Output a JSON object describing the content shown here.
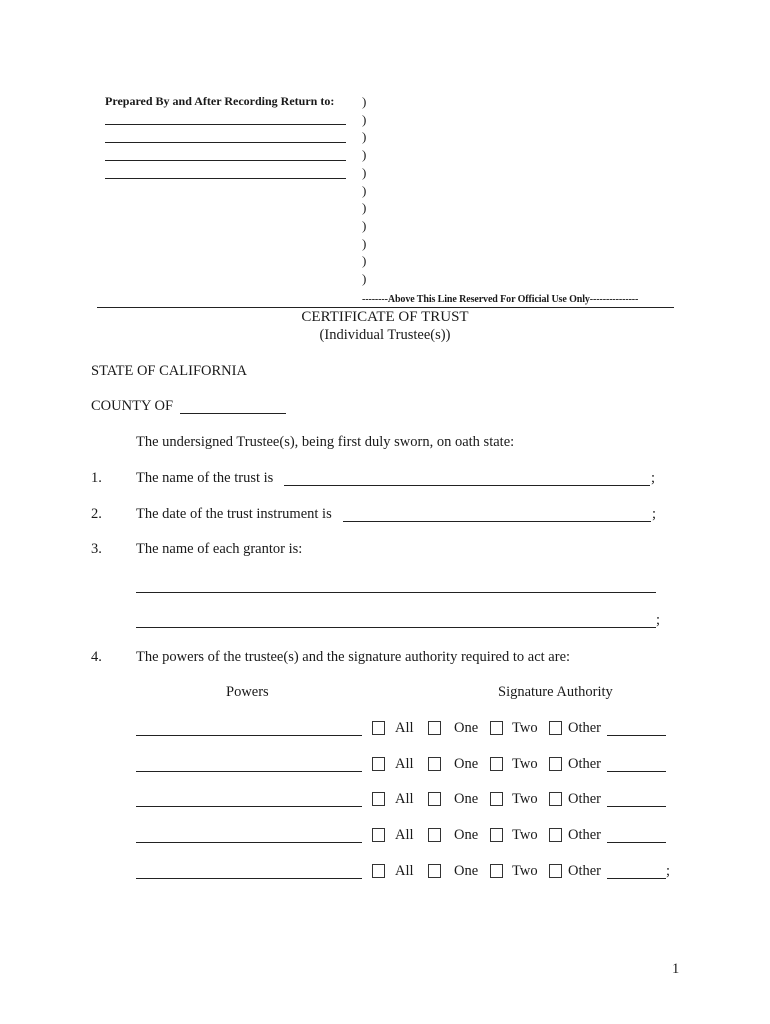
{
  "header": {
    "prepared_by_label": "Prepared By and After Recording Return to:",
    "return_lines": [
      "",
      "",
      "",
      ""
    ],
    "paren": ")",
    "paren_count": 11,
    "official_use_note": "--------Above This Line Reserved For Official Use Only---------------"
  },
  "title": {
    "main": "CERTIFICATE OF TRUST",
    "sub": "(Individual Trustee(s))"
  },
  "jurisdiction": {
    "state": "STATE OF CALIFORNIA",
    "county_label": "COUNTY OF",
    "county_value": ""
  },
  "intro": "The undersigned Trustee(s), being first duly sworn, on oath state:",
  "items": [
    {
      "num": "1.",
      "text": "The name of the trust is",
      "value": "",
      "end": ";"
    },
    {
      "num": "2.",
      "text": "The date of the trust instrument is",
      "value": "",
      "end": ";"
    },
    {
      "num": "3.",
      "text": "The name of each grantor is:",
      "values": [
        "",
        ""
      ],
      "end": ";"
    },
    {
      "num": "4.",
      "text": "The powers of the trustee(s) and the signature authority required to act are:"
    }
  ],
  "powers_table": {
    "col_powers": "Powers",
    "col_signature": "Signature Authority",
    "options": [
      "All",
      "One",
      "Two",
      "Other"
    ],
    "rows": [
      {
        "power": "",
        "all": false,
        "one": false,
        "two": false,
        "other": false,
        "other_value": "",
        "end": ""
      },
      {
        "power": "",
        "all": false,
        "one": false,
        "two": false,
        "other": false,
        "other_value": "",
        "end": ""
      },
      {
        "power": "",
        "all": false,
        "one": false,
        "two": false,
        "other": false,
        "other_value": "",
        "end": ""
      },
      {
        "power": "",
        "all": false,
        "one": false,
        "two": false,
        "other": false,
        "other_value": "",
        "end": ""
      },
      {
        "power": "",
        "all": false,
        "one": false,
        "two": false,
        "other": false,
        "other_value": "",
        "end": ";"
      }
    ]
  },
  "page_number": "1"
}
